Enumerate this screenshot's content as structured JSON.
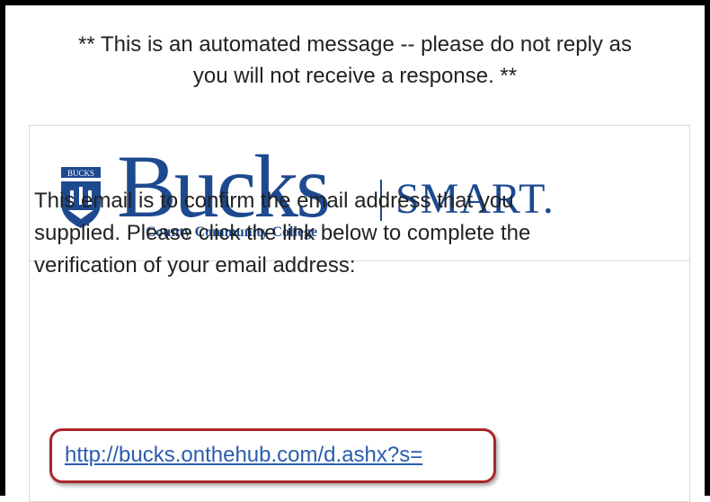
{
  "notice": {
    "line1": "** This is an automated message -- please do not reply as",
    "line2": "you will not receive a response. **"
  },
  "logo": {
    "crest_text": "BUCKS",
    "wordmark": "Bucks",
    "subtitle": "County Community College",
    "product": "SMART."
  },
  "body": {
    "line1": "This email is to confirm the email address that you",
    "line2": "supplied. Please click the link below to complete the",
    "line3": "verification of your email address:"
  },
  "link": {
    "text": "http://bucks.onthehub.com/d.ashx?s="
  },
  "colors": {
    "brand_blue": "#1d4a8f",
    "link_blue": "#2b5cb0",
    "highlight_red": "#a8262b"
  }
}
